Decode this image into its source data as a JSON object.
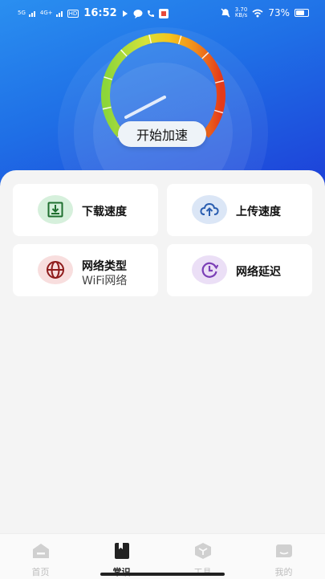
{
  "status_bar": {
    "network_1": "5G",
    "network_2": "4G+",
    "hd": "HD",
    "time": "16:52",
    "speed_value": "3.70",
    "speed_unit": "KB/s",
    "battery": "73%"
  },
  "gauge": {
    "start_button_label": "开始加速"
  },
  "cards": [
    {
      "title": "下载速度",
      "icon": "download-icon",
      "color": "#2b8a3e",
      "bg": "#d6f0dc"
    },
    {
      "title": "上传速度",
      "icon": "cloud-upload-icon",
      "color": "#2a5db0",
      "bg": "#dbe6f6"
    },
    {
      "title": "网络类型",
      "subtitle": "WiFi网络",
      "icon": "globe-icon",
      "color": "#b32424",
      "bg": "#f8dede"
    },
    {
      "title": "网络延迟",
      "icon": "clock-icon",
      "color": "#7b3fb6",
      "bg": "#ebdff6"
    }
  ],
  "tabbar": {
    "tabs": [
      {
        "label": "首页",
        "active": false
      },
      {
        "label": "常识",
        "active": true
      },
      {
        "label": "工具",
        "active": false
      },
      {
        "label": "我的",
        "active": false
      }
    ]
  }
}
